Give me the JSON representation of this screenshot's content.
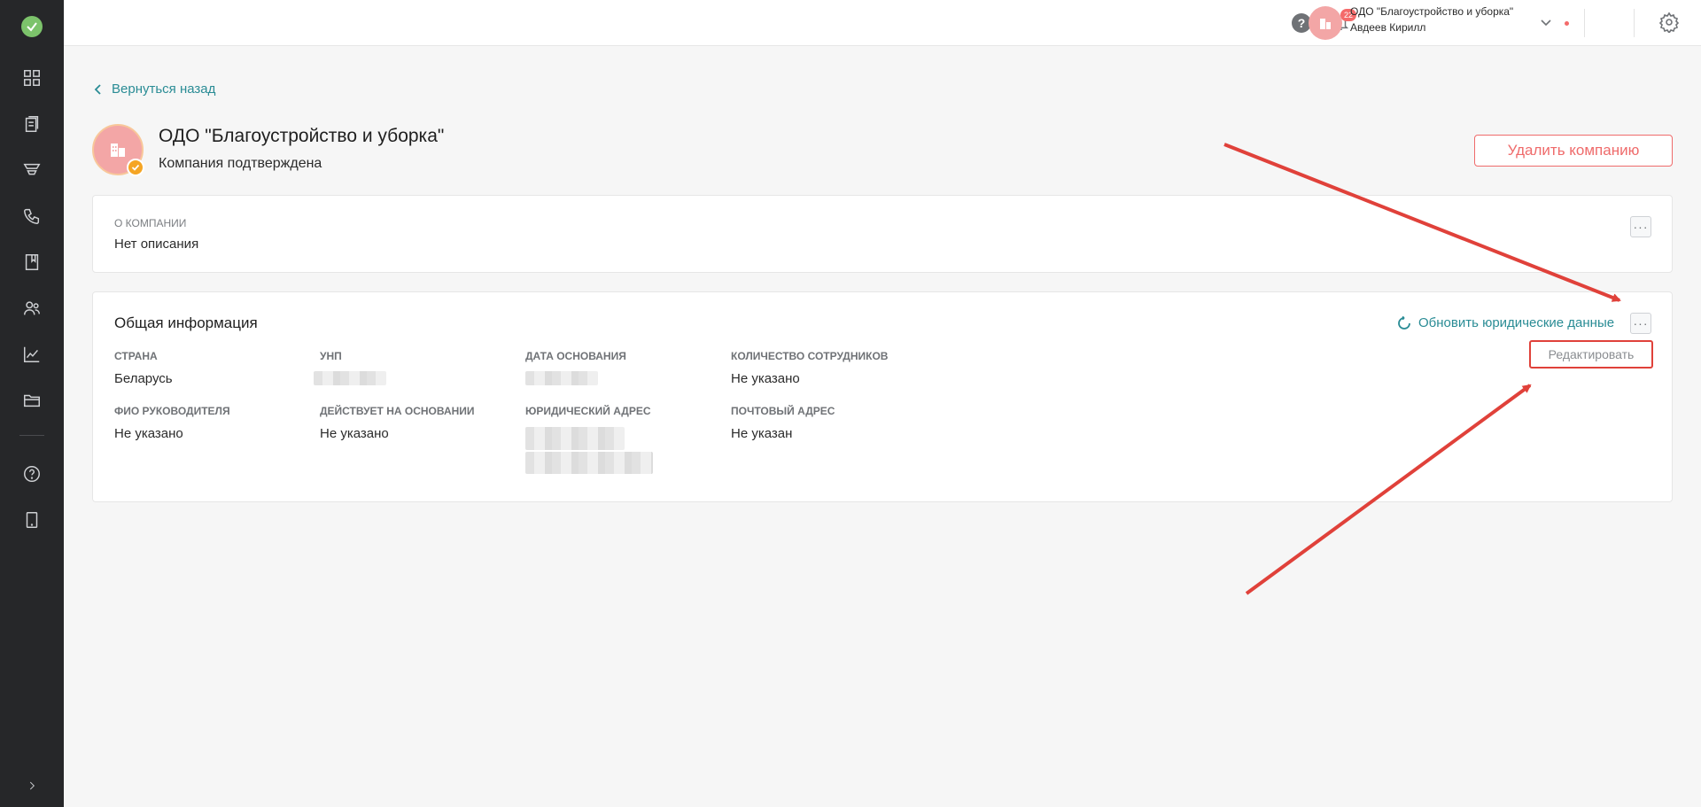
{
  "topbar": {
    "help_glyph": "?",
    "notifications_count": "22",
    "company_name": "ОДО \"Благоустройство и уборка\"",
    "user_name": "Авдеев Кирилл"
  },
  "page": {
    "back_label": "Вернуться назад",
    "company_title": "ОДО \"Благоустройство и уборка\"",
    "company_status": "Компания подтверждена",
    "delete_label": "Удалить компанию"
  },
  "about": {
    "label": "О компании",
    "value": "Нет описания",
    "more_glyph": "···"
  },
  "info": {
    "title": "Общая информация",
    "refresh_label": "Обновить юридические данные",
    "more_glyph": "···",
    "menu_edit": "Редактировать",
    "fields": {
      "country_label": "Страна",
      "country_value": "Беларусь",
      "unp_label": "УНП",
      "founded_label": "Дата основания",
      "employees_label": "Количество сотрудников",
      "employees_value": "Не указано",
      "director_label": "ФИО руководителя",
      "director_value": "Не указано",
      "basis_label": "Действует на основании",
      "basis_value": "Не указано",
      "legal_address_label": "Юридический адрес",
      "postal_address_label": "Почтовый адрес",
      "postal_address_value": "Не указан"
    }
  },
  "colors": {
    "accent_teal": "#2a8c95",
    "danger": "#ef6b6b",
    "sidebar_bg": "#262729",
    "annotation_red": "#e0413a"
  }
}
